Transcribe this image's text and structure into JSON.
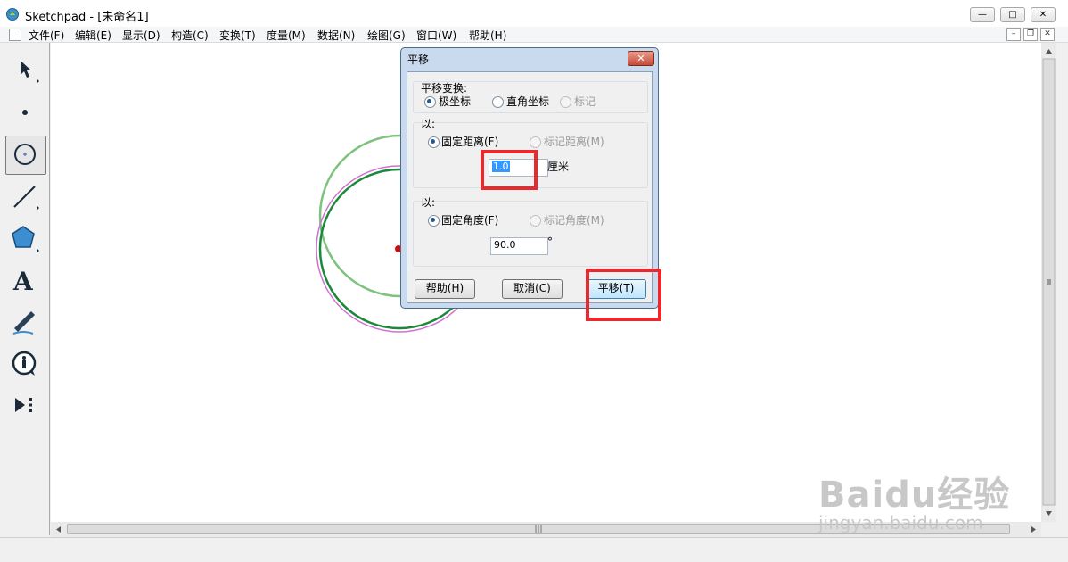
{
  "window": {
    "title": "Sketchpad  - [未命名1]",
    "minimize": "—",
    "maximize": "□",
    "close": "✕"
  },
  "menu": [
    "文件(F)",
    "编辑(E)",
    "显示(D)",
    "构造(C)",
    "变换(T)",
    "度量(M)",
    "数据(N)",
    "绘图(G)",
    "窗口(W)",
    "帮助(H)"
  ],
  "mdi": {
    "minimize": "–",
    "restore": "❐",
    "close": "✕"
  },
  "toolbox": {
    "tools": [
      "arrow-tool",
      "point-tool",
      "compass-tool",
      "straightedge-tool",
      "polygon-tool",
      "text-tool",
      "marker-tool",
      "information-tool",
      "custom-tool"
    ],
    "selected": "compass-tool",
    "text_tool_glyph": "A"
  },
  "canvas": {
    "circle_colors": [
      "#7dc27d",
      "#1a8a3a",
      "#d070d0"
    ],
    "point_color": "#d01010"
  },
  "dialog": {
    "title": "平移",
    "close": "✕",
    "transform_group": {
      "label": "平移变换:",
      "options": [
        "极坐标",
        "直角坐标",
        "标记"
      ],
      "selected": "极坐标"
    },
    "distance_group": {
      "label": "以:",
      "fixed": "固定距离(F)",
      "marked": "标记距离(M)",
      "value": "1.0",
      "unit": "厘米"
    },
    "angle_group": {
      "label": "以:",
      "fixed": "固定角度(F)",
      "marked": "标记角度(M)",
      "value": "90.0",
      "unit": "°"
    },
    "buttons": {
      "help": "帮助(H)",
      "cancel": "取消(C)",
      "translate": "平移(T)"
    }
  },
  "scrollbar": {
    "grip": "|||"
  },
  "watermark": {
    "main": "Baidu经验",
    "sub": "jingyan.baidu.com"
  },
  "highlight_color": "#e8292d"
}
